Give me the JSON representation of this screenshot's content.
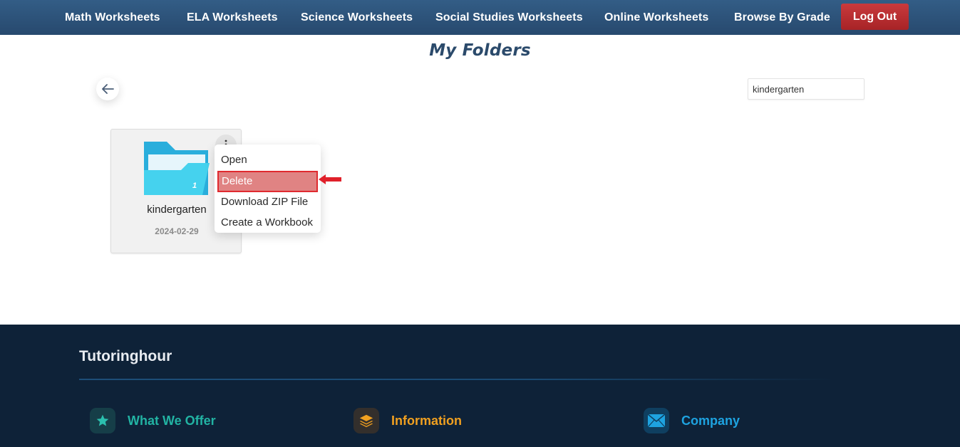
{
  "nav": {
    "items": [
      {
        "label": "Math Worksheets"
      },
      {
        "label": "ELA Worksheets"
      },
      {
        "label": "Science Worksheets"
      },
      {
        "label": "Social Studies Worksheets"
      },
      {
        "label": "Online Worksheets"
      },
      {
        "label": "Browse By Grade"
      }
    ],
    "logout_label": "Log Out"
  },
  "page": {
    "title": "My Folders",
    "back_icon": "arrow-left-icon",
    "search": {
      "value": "kindergarten",
      "placeholder": ""
    }
  },
  "folders": [
    {
      "name": "kindergarten",
      "date": "2024-02-29",
      "count": "1",
      "icon": "folder-icon",
      "color": "#2fb3e0"
    }
  ],
  "context_menu": {
    "items": [
      {
        "label": "Open"
      },
      {
        "label": "Delete",
        "highlighted": true
      },
      {
        "label": "Download ZIP File"
      },
      {
        "label": "Create a Workbook"
      }
    ],
    "highlight_color": "#e08383",
    "highlight_border": "#e02a2f"
  },
  "footer": {
    "brand": "Tutoringhour",
    "columns": [
      {
        "label": "What We Offer",
        "icon": "star-icon",
        "color": "#22b3a3"
      },
      {
        "label": "Information",
        "icon": "layers-icon",
        "color": "#f0a020"
      },
      {
        "label": "Company",
        "icon": "envelope-icon",
        "color": "#1ea3e0"
      }
    ]
  }
}
